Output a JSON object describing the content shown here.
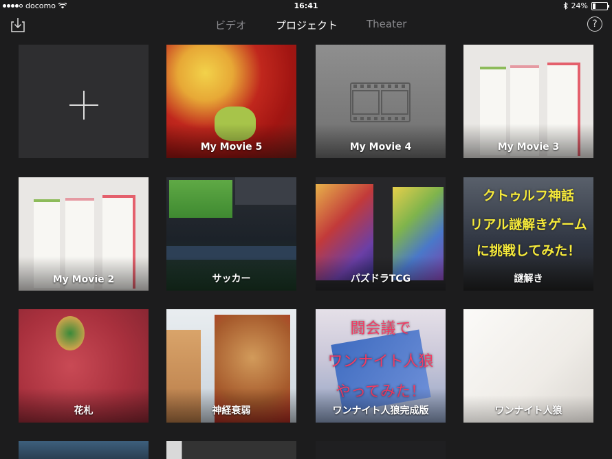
{
  "status_bar": {
    "carrier": "docomo",
    "time": "16:41",
    "battery": "24%",
    "battery_level": 0.24
  },
  "nav": {
    "tabs": [
      {
        "label": "ビデオ",
        "active": false
      },
      {
        "label": "プロジェクト",
        "active": true
      },
      {
        "label": "Theater",
        "active": false
      }
    ],
    "help_label": "?"
  },
  "projects": [
    {
      "label": "My Movie 5"
    },
    {
      "label": "My Movie 4"
    },
    {
      "label": "My Movie 3"
    },
    {
      "label": "My Movie 2"
    },
    {
      "label": "サッカー"
    },
    {
      "label": "パズドラTCG"
    },
    {
      "label": "謎解き"
    },
    {
      "label": "花札"
    },
    {
      "label": "神経衰弱"
    },
    {
      "label": "ワンナイト人狼完成版"
    },
    {
      "label": "ワンナイト人狼"
    }
  ],
  "thumbnail_text": {
    "nazotoki": [
      "クトゥルフ神話",
      "リアル謎解きゲーム",
      "に挑戦してみた！"
    ],
    "werewolf": [
      "闘会議で",
      "ワンナイト人狼",
      "やってみた！"
    ]
  }
}
